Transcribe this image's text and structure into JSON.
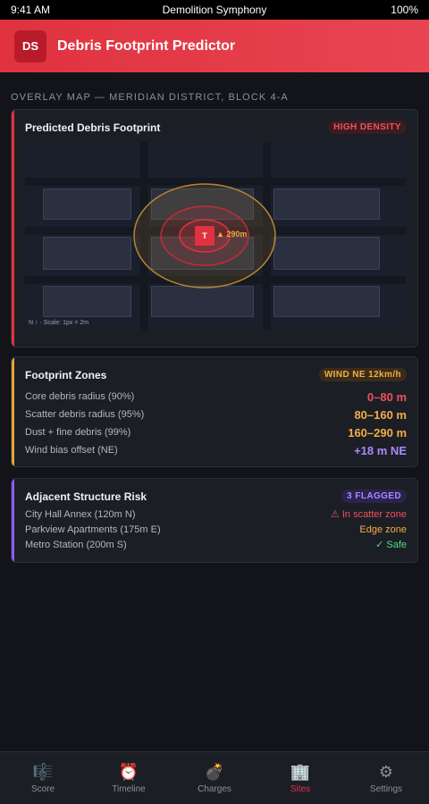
{
  "status": {
    "time": "9:41 AM",
    "app": "Demolition Symphony",
    "battery": "100%"
  },
  "header": {
    "logo": "DS",
    "title": "Debris Footprint Predictor"
  },
  "section_label": "OVERLAY MAP — MERIDIAN DISTRICT, BLOCK 4-A",
  "map_card": {
    "title": "Predicted Debris Footprint",
    "badge": "HIGH DENSITY",
    "target_label": "T",
    "radius_label": "▲ 290m",
    "scale": "N ↑ · Scale: 1px = 2m"
  },
  "zones": {
    "title": "Footprint Zones",
    "badge": "WIND NE 12km/h",
    "rows": [
      {
        "label": "Core debris radius (90%)",
        "value": "0–80 m",
        "color": "#f0505c"
      },
      {
        "label": "Scatter debris radius (95%)",
        "value": "80–160 m",
        "color": "#f2ad45"
      },
      {
        "label": "Dust + fine debris (99%)",
        "value": "160–290 m",
        "color": "#f2ad45"
      },
      {
        "label": "Wind bias offset (NE)",
        "value": "+18 m NE",
        "color": "#a78bfa"
      }
    ]
  },
  "risk": {
    "title": "Adjacent Structure Risk",
    "badge": "3 FLAGGED",
    "rows": [
      {
        "label": "City Hall Annex (120m N)",
        "value": "⚠ In scatter zone",
        "color": "#f0505c"
      },
      {
        "label": "Parkview Apartments (175m E)",
        "value": "Edge zone",
        "color": "#f2ad45"
      },
      {
        "label": "Metro Station (200m S)",
        "value": "✓ Safe",
        "color": "#4ade80"
      }
    ]
  },
  "tabs": [
    {
      "label": "Score",
      "icon": "🎼"
    },
    {
      "label": "Timeline",
      "icon": "⏰"
    },
    {
      "label": "Charges",
      "icon": "💣"
    },
    {
      "label": "Sites",
      "icon": "🏢"
    },
    {
      "label": "Settings",
      "icon": "⚙"
    }
  ],
  "active_tab": "Sites"
}
